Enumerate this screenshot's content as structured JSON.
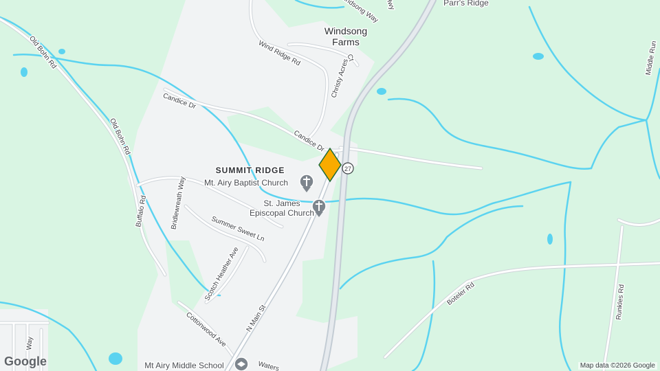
{
  "map": {
    "places": [
      {
        "name": "Windsong Farms",
        "line1": "Windsong",
        "line2": "Farms"
      },
      {
        "name": "Parr's Ridge"
      }
    ],
    "neighborhood": "SUMMIT RIDGE",
    "pois": [
      {
        "name": "Mt. Airy Baptist Church",
        "icon": "church-icon"
      },
      {
        "name": "St. James Episcopal Church",
        "line1": "St. James",
        "line2": "Episcopal Church",
        "icon": "church-icon"
      },
      {
        "name": "Mt Airy Middle School",
        "icon": "school-icon"
      }
    ],
    "roads": {
      "old_bohn_1": "Old Bohn Rd",
      "old_bohn_2": "Old Bohn Rd",
      "buffalo": "Buffalo Rd",
      "candice_1": "Candice Dr",
      "candice_2": "Candice Dr",
      "wind_ridge": "Wind Ridge Rd",
      "christy": "Christy Acres",
      "christy_ct": "Ct",
      "windsong_way": "Windsong Way",
      "hwy_top": "Hwy",
      "bridlewreath": "Bridlewreath Way",
      "summer_sweet": "Summer Sweet Ln",
      "scotch_heather": "Scotch Heather Ave",
      "n_main": "N Main St",
      "cottonwood": "Cottonwood Ave",
      "boteler": "Boteler Rd",
      "runkles": "Runkles Rd",
      "middle_run": "Middle Run",
      "waters": "Waters",
      "bottom_way": "Way"
    },
    "route_shield": "27",
    "marker": {
      "icon": "location-pin-icon",
      "color": "#f9ab00"
    },
    "attribution": "Map data ©2026 Google",
    "logo": "Google",
    "colors": {
      "park": "#d9f5e3",
      "urban": "#f1f3f4",
      "water": "#5bd3f0",
      "road": "#ffffff",
      "highway": "#c3ccd4"
    }
  }
}
